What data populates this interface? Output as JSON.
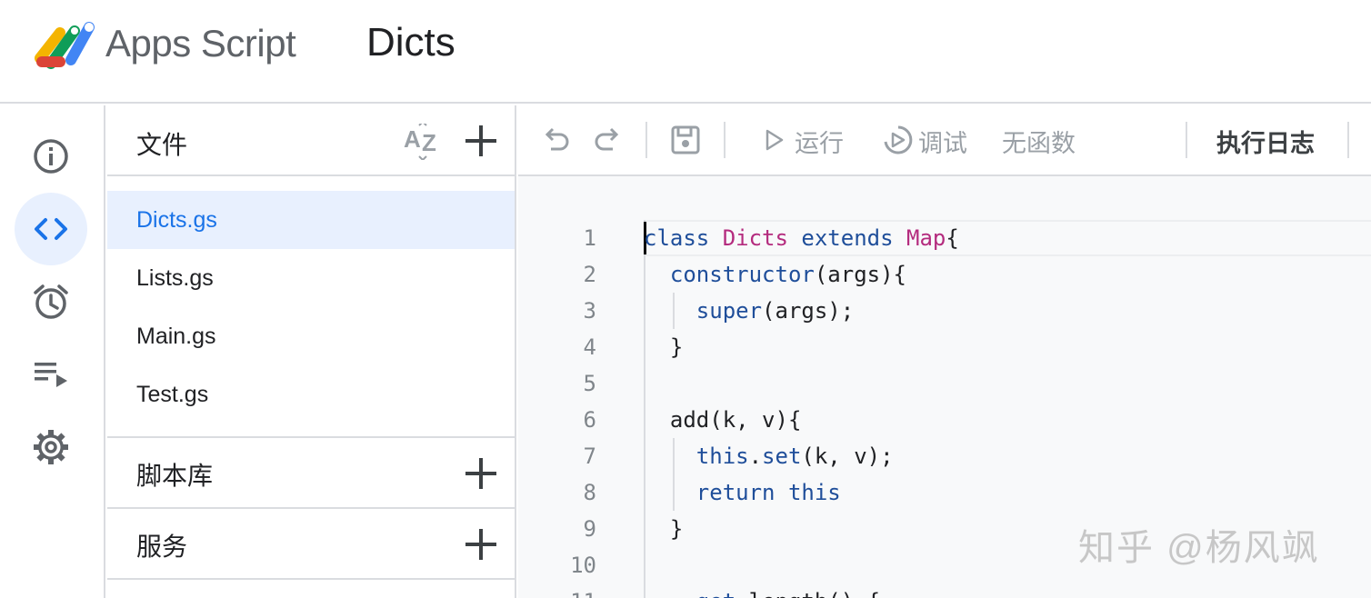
{
  "header": {
    "app_name": "Apps Script",
    "project_name": "Dicts"
  },
  "rail": {
    "items": [
      {
        "name": "overview",
        "icon": "info-icon"
      },
      {
        "name": "editor",
        "icon": "code-icon",
        "active": true
      },
      {
        "name": "triggers",
        "icon": "alarm-icon"
      },
      {
        "name": "executions",
        "icon": "playlist-play-icon"
      },
      {
        "name": "settings",
        "icon": "gear-icon"
      }
    ]
  },
  "files": {
    "title": "文件",
    "items": [
      {
        "label": "Dicts.gs",
        "active": true
      },
      {
        "label": "Lists.gs"
      },
      {
        "label": "Main.gs"
      },
      {
        "label": "Test.gs"
      }
    ],
    "libraries_title": "脚本库",
    "services_title": "服务"
  },
  "toolbar": {
    "run_label": "运行",
    "debug_label": "调试",
    "function_label": "无函数",
    "log_label": "执行日志"
  },
  "editor": {
    "lines": [
      {
        "n": "1"
      },
      {
        "n": "2"
      },
      {
        "n": "3"
      },
      {
        "n": "4"
      },
      {
        "n": "5"
      },
      {
        "n": "6"
      },
      {
        "n": "7"
      },
      {
        "n": "8"
      },
      {
        "n": "9"
      },
      {
        "n": "10"
      },
      {
        "n": "11"
      }
    ]
  },
  "watermark": "知乎 @杨风飒",
  "colors": {
    "accent": "#1a73e8",
    "active_bg": "#e8f0fe",
    "keyword": "#1f4e9a",
    "class_name": "#b42b7e"
  }
}
